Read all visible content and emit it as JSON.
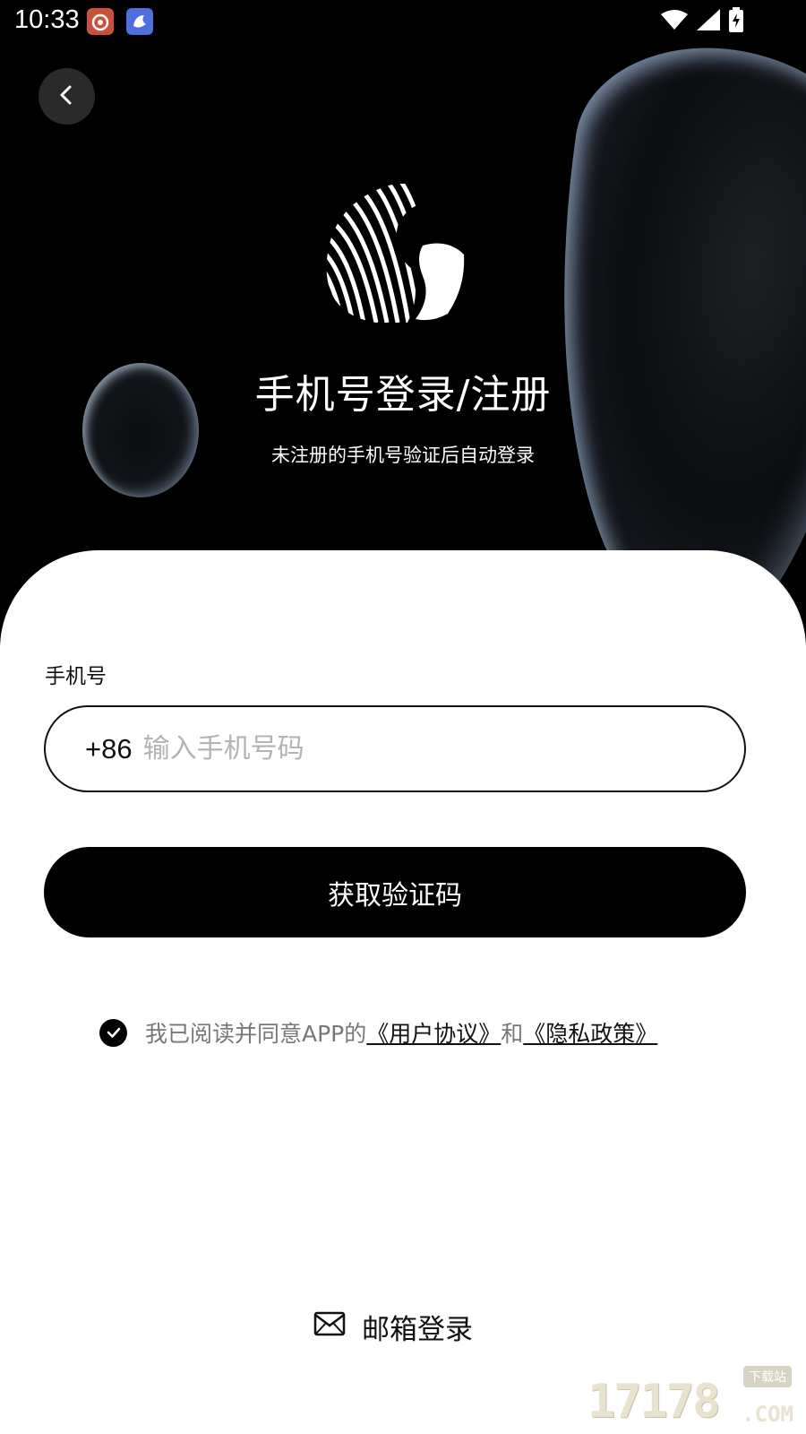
{
  "status_bar": {
    "time": "10:33",
    "notification_icons": [
      "weibo-icon",
      "app-notification-icon"
    ],
    "system_icons": [
      "wifi-icon",
      "signal-icon",
      "battery-charging-icon"
    ]
  },
  "header": {
    "back_icon": "chevron-left-icon",
    "title": "手机号登录/注册",
    "subtitle": "未注册的手机号验证后自动登录"
  },
  "form": {
    "phone_label": "手机号",
    "country_code": "+86",
    "phone_placeholder": "输入手机号码",
    "phone_value": "",
    "submit_label": "获取验证码"
  },
  "agreement": {
    "checked": true,
    "prefix": "我已阅读并同意APP的",
    "user_agreement": "《用户协议》",
    "conjunction": "和",
    "privacy_policy": "《隐私政策》"
  },
  "alt_login": {
    "icon": "mail-icon",
    "label": "邮箱登录"
  },
  "watermark": {
    "number": "17178",
    "tag": "下载站",
    "suffix": ".COM"
  },
  "colors": {
    "hero_background": "#000000",
    "primary_button": "#000000",
    "placeholder": "#b3b3b3",
    "muted_text": "#777777"
  }
}
